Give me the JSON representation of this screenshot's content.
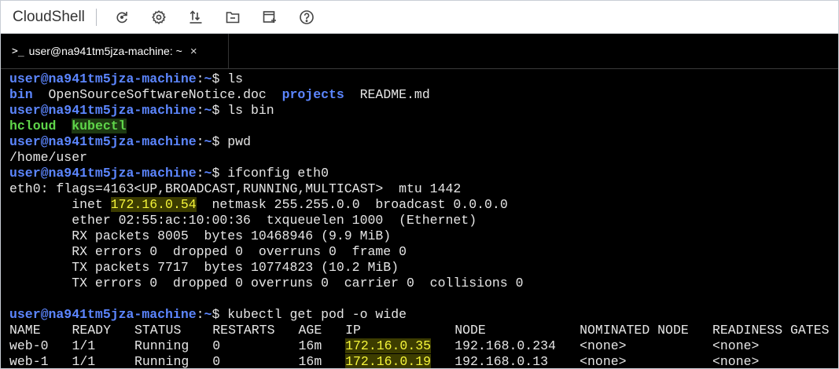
{
  "app": {
    "title": "CloudShell",
    "toolbar": [
      {
        "name": "refresh-icon"
      },
      {
        "name": "settings-icon"
      },
      {
        "name": "upload-icon"
      },
      {
        "name": "folder-icon"
      },
      {
        "name": "new-session-icon"
      },
      {
        "name": "help-icon"
      }
    ]
  },
  "tab": {
    "prompt_icon": ">_",
    "title": "user@na941tm5jza-machine: ~",
    "close": "×"
  },
  "terminal": {
    "prompt_user": "user@na941tm5jza-machine",
    "prompt_sep": ":",
    "prompt_dir": "~",
    "prompt_end": "$ ",
    "cmd1": "ls",
    "ls": {
      "bin": "bin",
      "notice": "OpenSourceSoftwareNotice.doc",
      "projects": "projects",
      "readme": "README.md"
    },
    "cmd2": "ls bin",
    "lsbin": {
      "hcloud": "hcloud",
      "kubectl": "kubectl"
    },
    "cmd3": "pwd",
    "pwd_out": "/home/user",
    "cmd4": "ifconfig eth0",
    "ifconfig": {
      "l1": "eth0: flags=4163<UP,BROADCAST,RUNNING,MULTICAST>  mtu 1442",
      "l2_pre": "        inet ",
      "l2_ip": "172.16.0.54",
      "l2_post": "  netmask 255.255.0.0  broadcast 0.0.0.0",
      "l3": "        ether 02:55:ac:10:00:36  txqueuelen 1000  (Ethernet)",
      "l4": "        RX packets 8005  bytes 10468946 (9.9 MiB)",
      "l5": "        RX errors 0  dropped 0  overruns 0  frame 0",
      "l6": "        TX packets 7717  bytes 10774823 (10.2 MiB)",
      "l7": "        TX errors 0  dropped 0 overruns 0  carrier 0  collisions 0"
    },
    "cmd5": "kubectl get pod -o wide",
    "pods": {
      "headers": [
        "NAME",
        "READY",
        "STATUS",
        "RESTARTS",
        "AGE",
        "IP",
        "NODE",
        "NOMINATED NODE",
        "READINESS GATES"
      ],
      "rows": [
        [
          "web-0",
          "1/1",
          "Running",
          "0",
          "16m",
          "172.16.0.35",
          "192.168.0.234",
          "<none>",
          "<none>"
        ],
        [
          "web-1",
          "1/1",
          "Running",
          "0",
          "16m",
          "172.16.0.19",
          "192.168.0.13",
          "<none>",
          "<none>"
        ]
      ]
    }
  }
}
